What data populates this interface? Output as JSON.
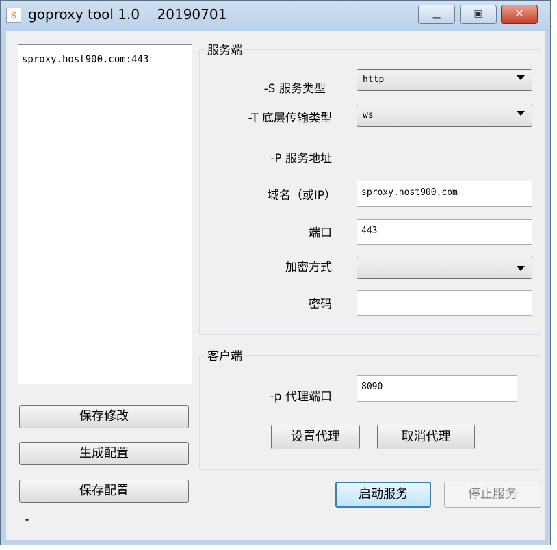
{
  "window": {
    "title": "goproxy tool 1.0    20190701",
    "app_icon": "goproxy-icon",
    "controls": {
      "minimize": "minimize-icon",
      "maximize": "maximize-icon",
      "close": "close-icon"
    }
  },
  "left": {
    "list_items": [
      "sproxy.host900.com:443"
    ],
    "buttons": {
      "save_changes": "保存修改",
      "generate_config": "生成配置",
      "save_config": "保存配置"
    },
    "status": "*"
  },
  "server": {
    "group_title": "服务端",
    "service_type_label": "-S 服务类型",
    "service_type_value": "http",
    "transport_label": "-T 底层传输类型",
    "transport_value": "ws",
    "address_label": "-P 服务地址",
    "domain_label": "域名（或IP）",
    "domain_value": "sproxy.host900.com",
    "port_label": "端口",
    "port_value": "443",
    "encryption_label": "加密方式",
    "encryption_value": "",
    "password_label": "密码",
    "password_value": ""
  },
  "client": {
    "group_title": "客户端",
    "proxy_port_label": "-p 代理端口",
    "proxy_port_value": "8090",
    "set_proxy": "设置代理",
    "cancel_proxy": "取消代理"
  },
  "actions": {
    "start_service": "启动服务",
    "stop_service": "停止服务"
  }
}
